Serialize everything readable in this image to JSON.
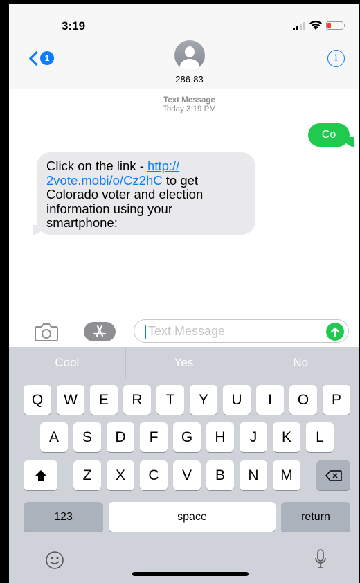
{
  "status_bar": {
    "time": "3:19"
  },
  "header": {
    "back_badge": "1",
    "contact_name": "286-83",
    "info_glyph": "i"
  },
  "thread": {
    "service_label": "Text Message",
    "timestamp": "Today 3:19 PM",
    "messages": [
      {
        "direction": "outgoing",
        "text": "Co"
      },
      {
        "direction": "incoming",
        "text_before": "Click on the link - ",
        "link": "http://2vote.mobi/o/Cz2hC",
        "link_line1": "http://",
        "link_line2": "2vote.mobi/o/Cz2hC",
        "text_after": " to get Colorado voter and election information using  your smartphone:"
      }
    ]
  },
  "compose": {
    "placeholder": "Text Message",
    "value": ""
  },
  "keyboard": {
    "predictions": [
      "Cool",
      "Yes",
      "No"
    ],
    "row1": [
      "Q",
      "W",
      "E",
      "R",
      "T",
      "Y",
      "U",
      "I",
      "O",
      "P"
    ],
    "row2": [
      "A",
      "S",
      "D",
      "F",
      "G",
      "H",
      "J",
      "K",
      "L"
    ],
    "row3": [
      "Z",
      "X",
      "C",
      "V",
      "B",
      "N",
      "M"
    ],
    "numbers_label": "123",
    "space_label": "space",
    "return_label": "return"
  },
  "colors": {
    "accent": "#0a7cff",
    "bubble_out": "#1fca4e",
    "bubble_in": "#e9e9eb",
    "keyboard_bg": "#cfd3d9"
  }
}
